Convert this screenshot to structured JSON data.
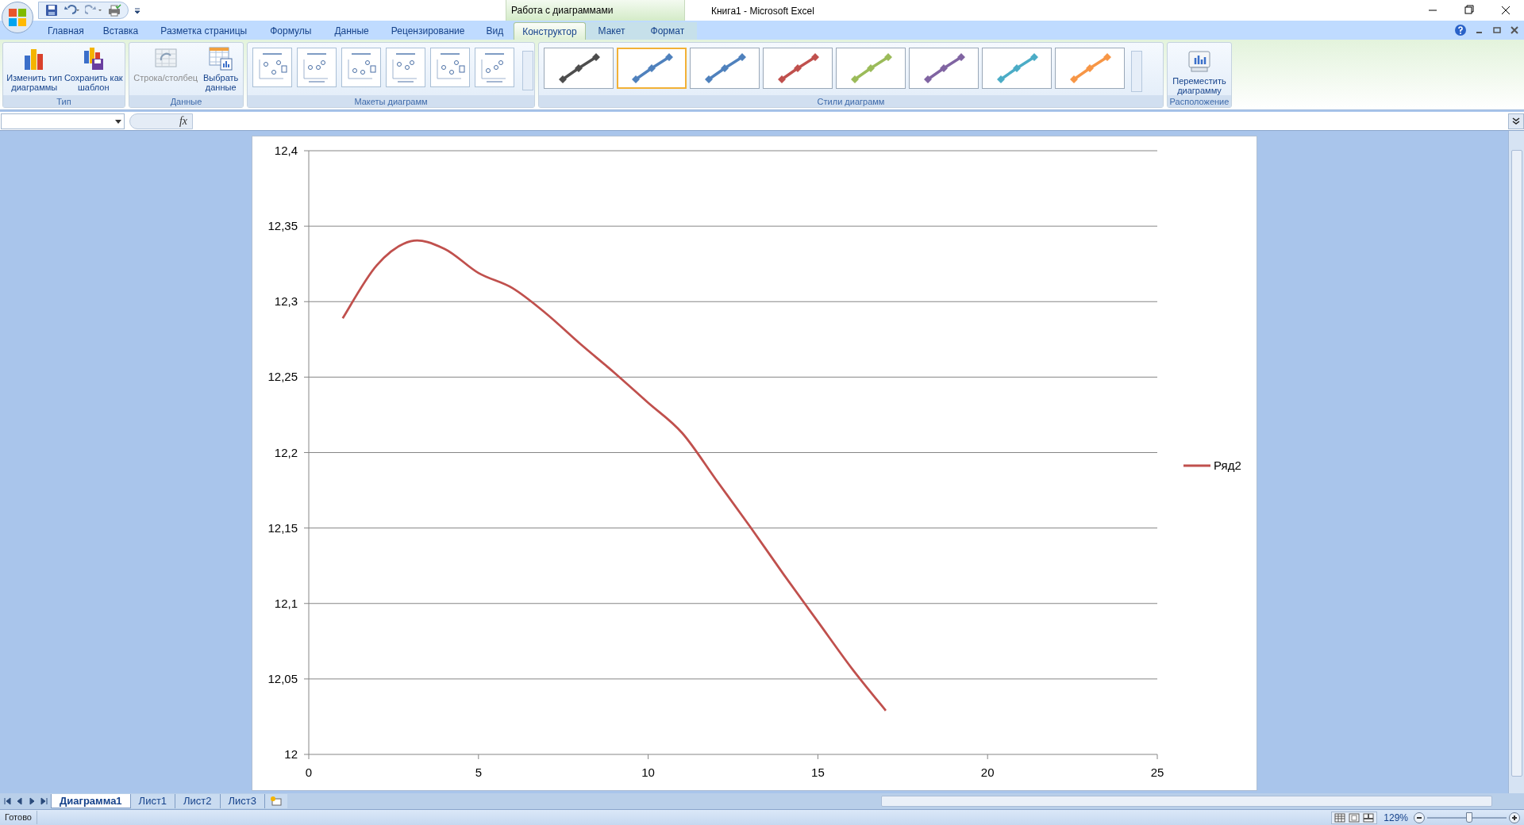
{
  "window": {
    "title": "Книга1 - Microsoft Excel",
    "context_group": "Работа с диаграммами"
  },
  "tabs": [
    {
      "label": "Главная",
      "selected": false,
      "contextual": false
    },
    {
      "label": "Вставка",
      "selected": false,
      "contextual": false
    },
    {
      "label": "Разметка страницы",
      "selected": false,
      "contextual": false
    },
    {
      "label": "Формулы",
      "selected": false,
      "contextual": false
    },
    {
      "label": "Данные",
      "selected": false,
      "contextual": false
    },
    {
      "label": "Рецензирование",
      "selected": false,
      "contextual": false
    },
    {
      "label": "Вид",
      "selected": false,
      "contextual": false
    },
    {
      "label": "Конструктор",
      "selected": true,
      "contextual": true
    },
    {
      "label": "Макет",
      "selected": false,
      "contextual": true
    },
    {
      "label": "Формат",
      "selected": false,
      "contextual": true
    }
  ],
  "ribbon": {
    "type_group": {
      "label": "Тип",
      "buttons": [
        {
          "label": "Изменить тип диаграммы",
          "disabled": false
        },
        {
          "label": "Сохранить как шаблон",
          "disabled": false
        }
      ]
    },
    "data_group": {
      "label": "Данные",
      "buttons": [
        {
          "label": "Строка/столбец",
          "disabled": true
        },
        {
          "label": "Выбрать данные",
          "disabled": false
        }
      ]
    },
    "layouts_group": {
      "label": "Макеты диаграмм"
    },
    "styles_group": {
      "label": "Стили диаграмм",
      "styles": [
        {
          "color": "#4d4d4d",
          "selected": false
        },
        {
          "color": "#4f81bd",
          "selected": true
        },
        {
          "color": "#4f81bd",
          "selected": false
        },
        {
          "color": "#c0504d",
          "selected": false
        },
        {
          "color": "#9bbb59",
          "selected": false
        },
        {
          "color": "#8064a2",
          "selected": false
        },
        {
          "color": "#4bacc6",
          "selected": false
        },
        {
          "color": "#f79646",
          "selected": false
        }
      ]
    },
    "location_group": {
      "label": "Расположение",
      "button": "Переместить диаграмму"
    }
  },
  "formula_bar": {
    "fx": "fx"
  },
  "chart_data": {
    "type": "line",
    "grid": true,
    "x": [
      1,
      2,
      3,
      4,
      5,
      6,
      7,
      8,
      9,
      10,
      11,
      12,
      13,
      14,
      15,
      16,
      17
    ],
    "series": [
      {
        "name": "Ряд2",
        "color": "#c0504d",
        "values": [
          12.289,
          12.324,
          12.34,
          12.335,
          12.319,
          12.309,
          12.292,
          12.272,
          12.253,
          12.233,
          12.213,
          12.182,
          12.151,
          12.119,
          12.088,
          12.057,
          12.029
        ]
      }
    ],
    "xlim": [
      0,
      25
    ],
    "ylim": [
      12,
      12.4
    ],
    "xticks": [
      0,
      5,
      10,
      15,
      20,
      25
    ],
    "yticks": [
      {
        "value": 12,
        "label": "12"
      },
      {
        "value": 12.05,
        "label": "12,05"
      },
      {
        "value": 12.1,
        "label": "12,1"
      },
      {
        "value": 12.15,
        "label": "12,15"
      },
      {
        "value": 12.2,
        "label": "12,2"
      },
      {
        "value": 12.25,
        "label": "12,25"
      },
      {
        "value": 12.3,
        "label": "12,3"
      },
      {
        "value": 12.35,
        "label": "12,35"
      },
      {
        "value": 12.4,
        "label": "12,4"
      }
    ]
  },
  "sheet_tabs": [
    {
      "label": "Диаграмма1",
      "selected": true
    },
    {
      "label": "Лист1",
      "selected": false
    },
    {
      "label": "Лист2",
      "selected": false
    },
    {
      "label": "Лист3",
      "selected": false
    }
  ],
  "status_bar": {
    "status": "Готово",
    "zoom": "129%",
    "zoom_slider": {
      "level": 0.53
    }
  }
}
